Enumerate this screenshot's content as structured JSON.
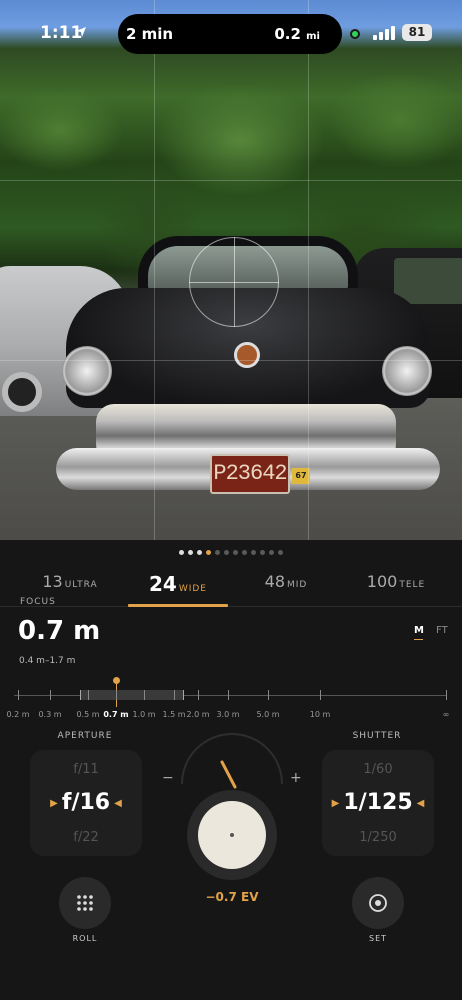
{
  "status": {
    "time": "1:11",
    "pill_left": "2 min",
    "pill_right_value": "0.2",
    "pill_right_unit": "mi",
    "battery": "81"
  },
  "viewfinder": {
    "plate_text": "P23642",
    "plate_tag": "67"
  },
  "lenses": [
    {
      "num": "13",
      "name": "ULTRA"
    },
    {
      "num": "24",
      "name": "WIDE"
    },
    {
      "num": "48",
      "name": "MID"
    },
    {
      "num": "100",
      "name": "TELE"
    }
  ],
  "active_lens_index": 1,
  "page_dots": {
    "count": 12,
    "white": [
      0,
      1,
      2
    ],
    "active": 3
  },
  "focus": {
    "label": "FOCUS",
    "value": "0.7 m",
    "range": "0.4 m–1.7 m",
    "unit_m": "M",
    "unit_ft": "FT",
    "scale_labels": [
      "0.2 m",
      "0.3 m",
      "0.5 m",
      "0.7 m",
      "1.0 m",
      "1.5 m",
      "2.0 m",
      "3.0 m",
      "5.0 m",
      "10 m",
      "∞"
    ],
    "current_label_index": 3
  },
  "aperture": {
    "label": "APERTURE",
    "prev": "f/11",
    "current": "f/16",
    "next": "f/22"
  },
  "shutter": {
    "label": "SHUTTER",
    "prev": "1/60",
    "current": "1/125",
    "next": "1/250"
  },
  "exposure": {
    "minus": "−",
    "plus": "+",
    "value": "−0.7 EV"
  },
  "buttons": {
    "roll": "ROLL",
    "set": "SET"
  },
  "colors": {
    "accent": "#e2a24a",
    "background": "#161616"
  }
}
